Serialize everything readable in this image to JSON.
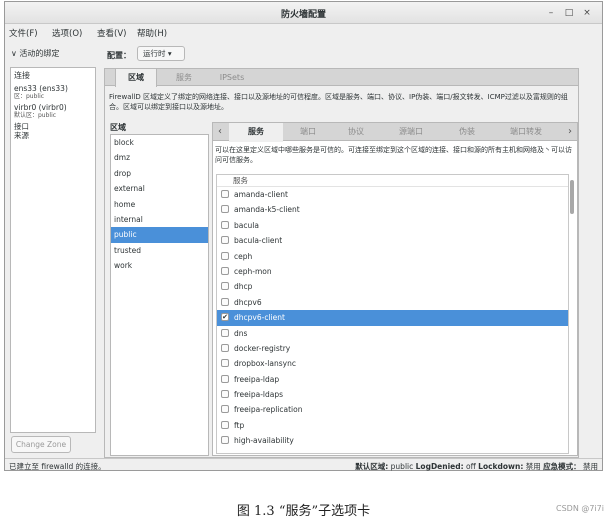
{
  "window": {
    "title": "防火墙配置"
  },
  "window_controls": {
    "minimize": "–",
    "maximize": "□",
    "close": "×"
  },
  "menu": [
    "文件(F)",
    "选项(O)",
    "查看(V)",
    "帮助(H)"
  ],
  "left_panel": {
    "toggle_label": "∨ 活动的绑定",
    "list_header": "连接",
    "connections": [
      {
        "name": "ens33 (ens33)",
        "zone": "区：public"
      },
      {
        "name": "virbr0 (virbr0)",
        "zone": "默认区：public"
      }
    ],
    "sections": [
      "接口",
      "来源"
    ],
    "change_zone_button": "Change Zone"
  },
  "config": {
    "label": "配置：",
    "value": "运行时 ▾"
  },
  "main_tabs": [
    "区域",
    "服务",
    "IPSets"
  ],
  "zone_description": "FirewallD 区域定义了绑定的网络连接、接口以及源地址的可信程度。区域是服务、端口、协议、IP伪装、端口/报文转发、ICMP过滤以及富规则的组合。区域可以绑定到接口以及源地址。",
  "zones_header": "区域",
  "zones": [
    "block",
    "dmz",
    "drop",
    "external",
    "home",
    "internal",
    "public",
    "trusted",
    "work"
  ],
  "selected_zone": "public",
  "service_tabs": [
    "服务",
    "端口",
    "协议",
    "源端口",
    "伪装",
    "端口转发"
  ],
  "nav": {
    "prev": "‹",
    "next": "›"
  },
  "services_description": "可以在这里定义区域中哪些服务是可信的。可连接至绑定到这个区域的连接、接口和源的所有主机和网络及丶可以访问可信服务。",
  "services_header": "服务",
  "services": [
    {
      "name": "amanda-client",
      "checked": false
    },
    {
      "name": "amanda-k5-client",
      "checked": false
    },
    {
      "name": "bacula",
      "checked": false
    },
    {
      "name": "bacula-client",
      "checked": false
    },
    {
      "name": "ceph",
      "checked": false
    },
    {
      "name": "ceph-mon",
      "checked": false
    },
    {
      "name": "dhcp",
      "checked": false
    },
    {
      "name": "dhcpv6",
      "checked": false
    },
    {
      "name": "dhcpv6-client",
      "checked": true,
      "selected": true
    },
    {
      "name": "dns",
      "checked": false
    },
    {
      "name": "docker-registry",
      "checked": false
    },
    {
      "name": "dropbox-lansync",
      "checked": false
    },
    {
      "name": "freeipa-ldap",
      "checked": false
    },
    {
      "name": "freeipa-ldaps",
      "checked": false
    },
    {
      "name": "freeipa-replication",
      "checked": false
    },
    {
      "name": "ftp",
      "checked": false
    },
    {
      "name": "high-availability",
      "checked": false
    }
  ],
  "status": {
    "left": "已建立至 firewalld 的连接。",
    "default_zone_label": "默认区域:",
    "default_zone_value": "public",
    "log_denied_label": "LogDenied:",
    "log_denied_value": "off",
    "lockdown_label": "Lockdown:",
    "lockdown_value": "禁用",
    "panic_label": "应急模式：",
    "panic_value": "禁用"
  },
  "caption": "图 1.3 “服务”子选项卡",
  "watermark": "CSDN @7i7i"
}
